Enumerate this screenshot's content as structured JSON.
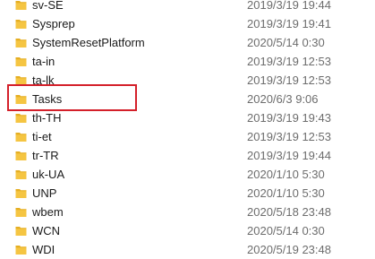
{
  "colors": {
    "folder_body": "#f5c542",
    "folder_tab": "#e5ae22",
    "highlight": "#d4202a",
    "date_text": "#6d6d6d"
  },
  "folders": [
    {
      "name": "sv-SE",
      "modified": "2019/3/19 19:44",
      "icon": "folder-icon"
    },
    {
      "name": "Sysprep",
      "modified": "2019/3/19 19:41",
      "icon": "folder-icon"
    },
    {
      "name": "SystemResetPlatform",
      "modified": "2020/5/14 0:30",
      "icon": "folder-icon"
    },
    {
      "name": "ta-in",
      "modified": "2019/3/19 12:53",
      "icon": "folder-icon"
    },
    {
      "name": "ta-lk",
      "modified": "2019/3/19 12:53",
      "icon": "folder-icon"
    },
    {
      "name": "Tasks",
      "modified": "2020/6/3 9:06",
      "icon": "folder-icon",
      "highlighted": true
    },
    {
      "name": "th-TH",
      "modified": "2019/3/19 19:43",
      "icon": "folder-icon"
    },
    {
      "name": "ti-et",
      "modified": "2019/3/19 12:53",
      "icon": "folder-icon"
    },
    {
      "name": "tr-TR",
      "modified": "2019/3/19 19:44",
      "icon": "folder-icon"
    },
    {
      "name": "uk-UA",
      "modified": "2020/1/10 5:30",
      "icon": "folder-icon"
    },
    {
      "name": "UNP",
      "modified": "2020/1/10 5:30",
      "icon": "folder-icon"
    },
    {
      "name": "wbem",
      "modified": "2020/5/18 23:48",
      "icon": "folder-icon"
    },
    {
      "name": "WCN",
      "modified": "2020/5/14 0:30",
      "icon": "folder-icon"
    },
    {
      "name": "WDI",
      "modified": "2020/5/19 23:48",
      "icon": "folder-icon"
    }
  ]
}
